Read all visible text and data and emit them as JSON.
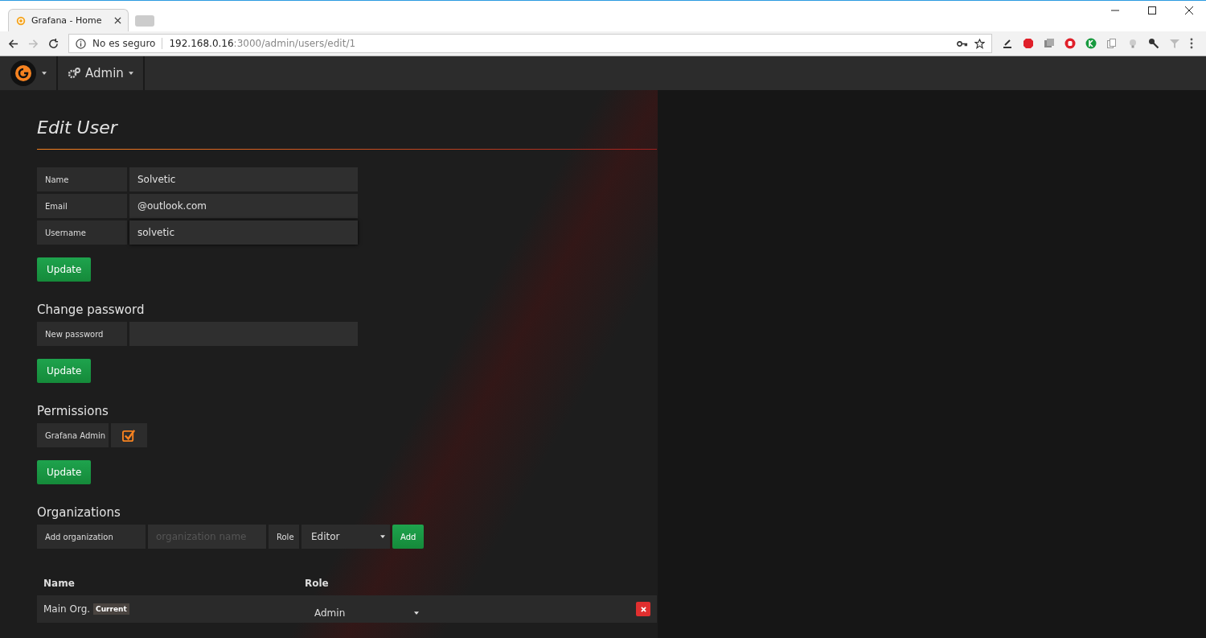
{
  "browser": {
    "tab_title": "Grafana - Home",
    "security": "No es seguro",
    "url_host": "192.168.0.16",
    "url_path": ":3000/admin/users/edit/1"
  },
  "navbar": {
    "section": "Admin"
  },
  "page": {
    "title": "Edit User"
  },
  "profile": {
    "fields": [
      {
        "label": "Name",
        "value": "Solvetic",
        "focused": false
      },
      {
        "label": "Email",
        "value": "@outlook.com",
        "focused": false
      },
      {
        "label": "Username",
        "value": "solvetic",
        "focused": true
      }
    ],
    "button": "Update"
  },
  "password": {
    "heading": "Change password",
    "label": "New password",
    "button": "Update"
  },
  "permissions": {
    "heading": "Permissions",
    "label": "Grafana Admin",
    "checked": true,
    "button": "Update"
  },
  "organizations": {
    "heading": "Organizations",
    "add_label": "Add organization",
    "name_placeholder": "organization name",
    "role_label": "Role",
    "role_value": "Editor",
    "add_button": "Add",
    "columns": [
      "Name",
      "Role"
    ],
    "rows": [
      {
        "name": "Main Org.",
        "badge": "Current",
        "role": "Admin"
      }
    ]
  }
}
